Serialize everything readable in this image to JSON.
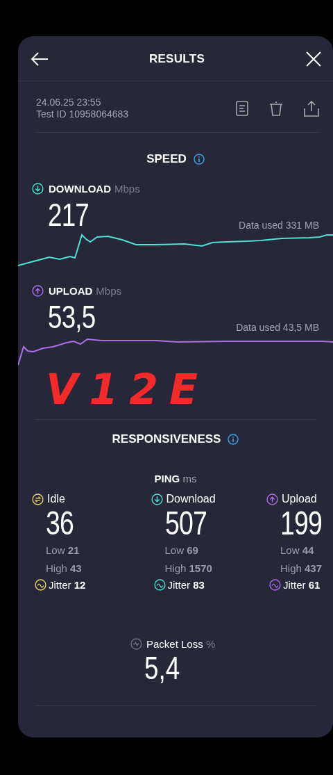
{
  "header": {
    "title": "RESULTS"
  },
  "test": {
    "date": "24.06.25 23:55",
    "test_id": "Test ID 10958064683"
  },
  "speed": {
    "title": "SPEED",
    "metrics": [
      {
        "kind": "download",
        "label": "DOWNLOAD",
        "unit": "Mbps",
        "value": "217",
        "data_used": "Data used 331 MB",
        "color": "#4fe0d6"
      },
      {
        "kind": "upload",
        "label": "UPLOAD",
        "unit": "Mbps",
        "value": "53,5",
        "data_used": "Data used 43,5 MB",
        "color": "#a970ea"
      }
    ]
  },
  "annotation": "V12E",
  "responsiveness": {
    "title": "RESPONSIVENESS",
    "ping_label": "PING",
    "ping_unit": "ms",
    "columns": [
      {
        "kind": "idle",
        "label": "Idle",
        "value": "36",
        "low_label": "Low",
        "low": "21",
        "high_label": "High",
        "high": "43",
        "jitter_label": "Jitter",
        "jitter": "12",
        "color": "#e9d66b"
      },
      {
        "kind": "download",
        "label": "Download",
        "value": "507",
        "low_label": "Low",
        "low": "69",
        "high_label": "High",
        "high": "1570",
        "jitter_label": "Jitter",
        "jitter": "83",
        "color": "#4fe0d6"
      },
      {
        "kind": "upload",
        "label": "Upload",
        "value": "199",
        "low_label": "Low",
        "low": "44",
        "high_label": "High",
        "high": "437",
        "jitter_label": "Jitter",
        "jitter": "61",
        "color": "#a970ea"
      }
    ],
    "packet_loss": {
      "label": "Packet Loss",
      "unit": "%",
      "value": "5,4"
    }
  }
}
